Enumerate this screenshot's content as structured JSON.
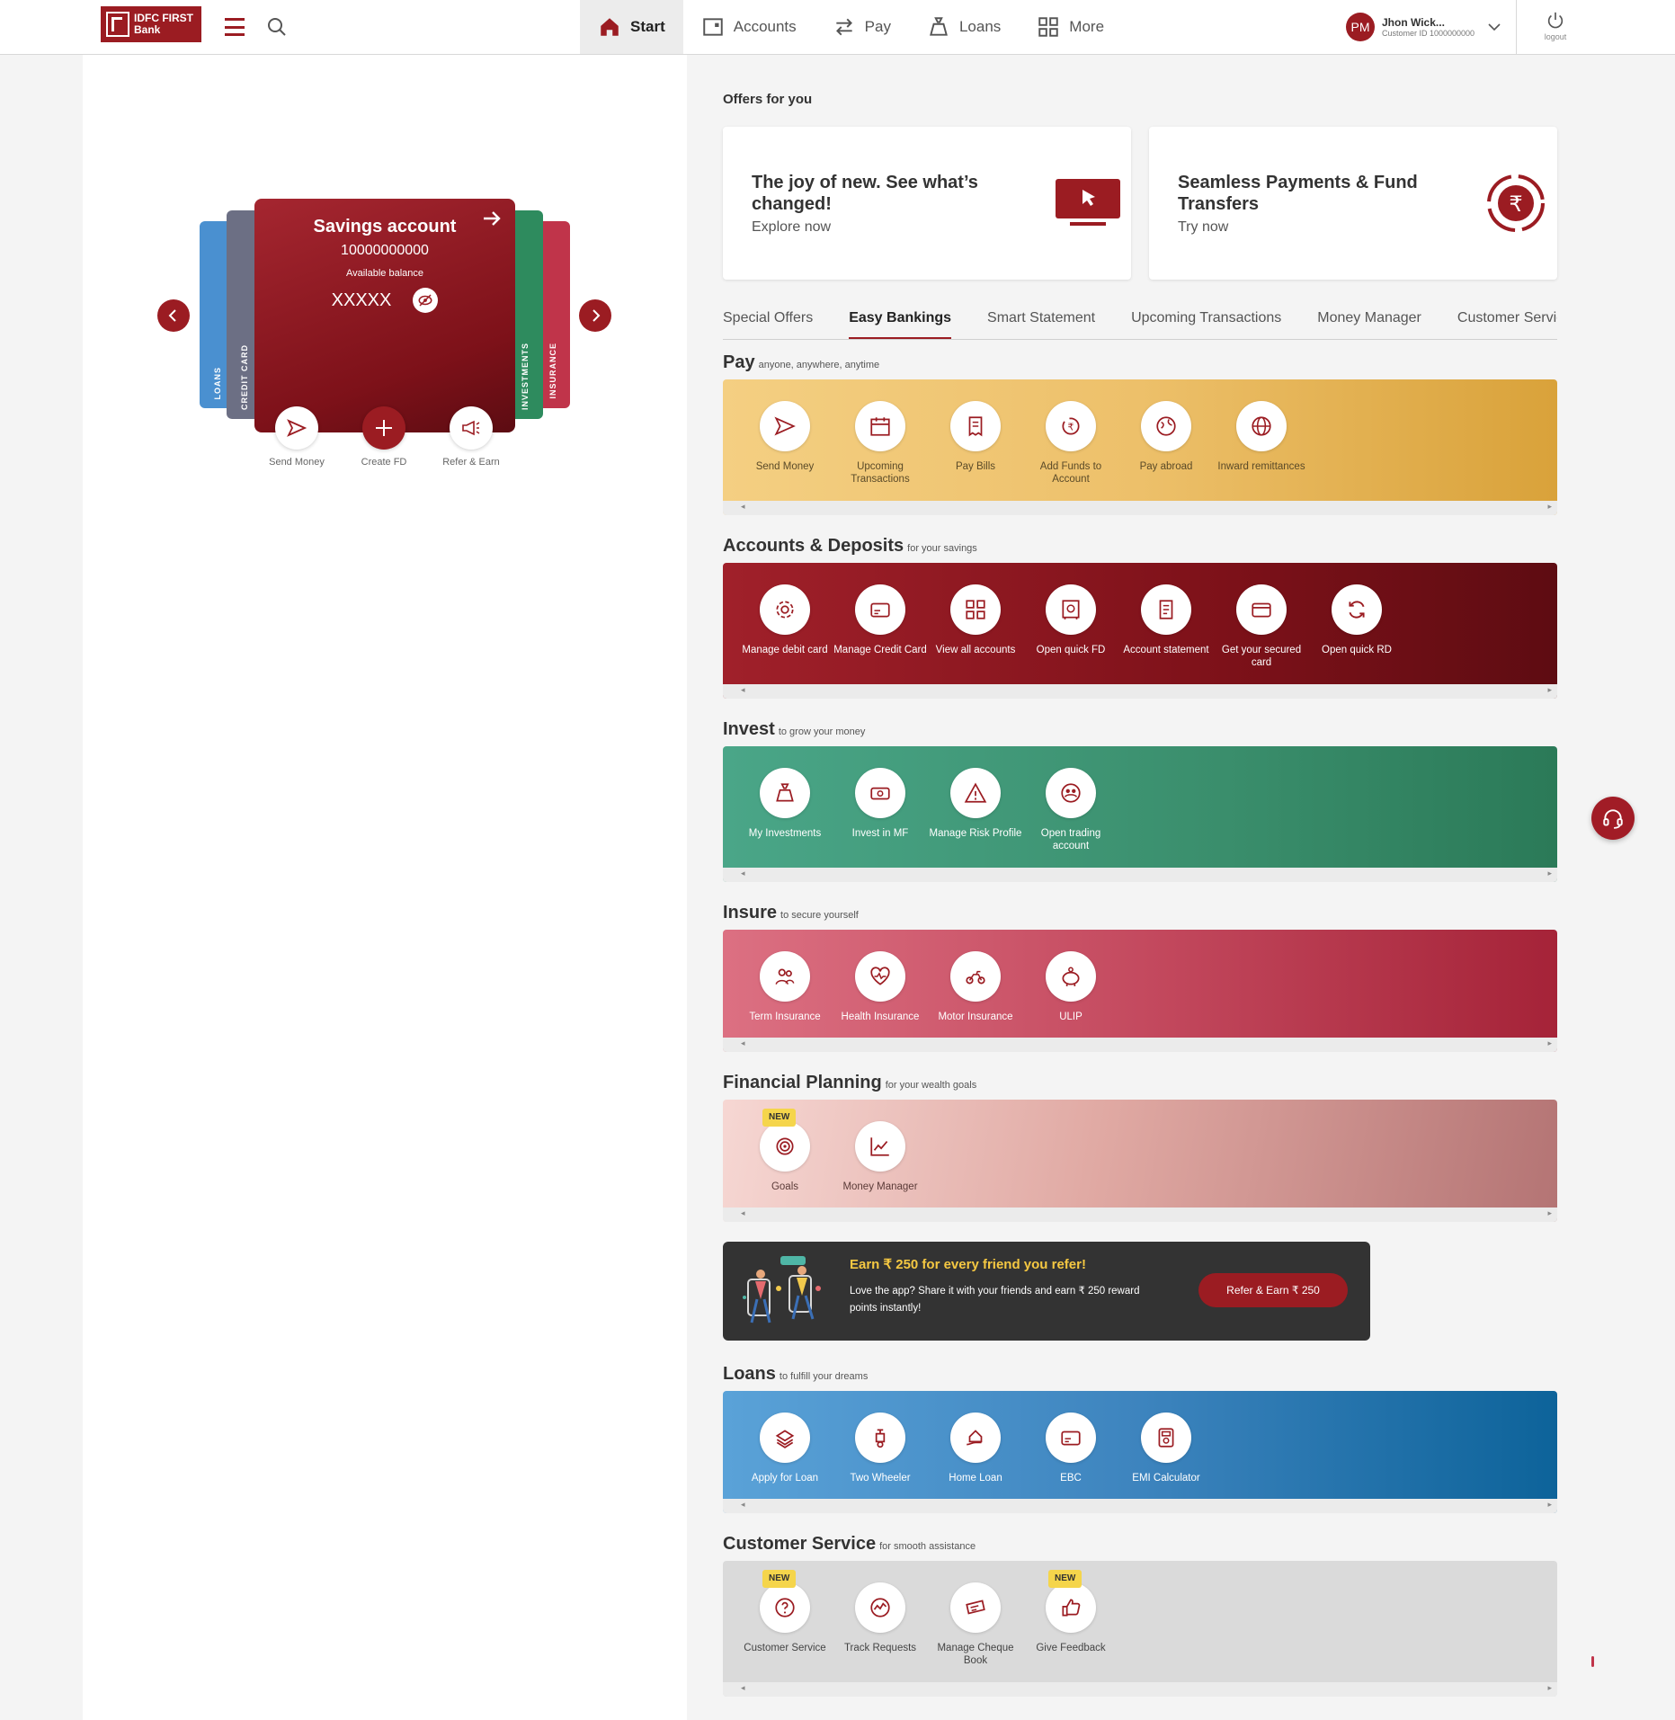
{
  "brand": {
    "name_line1": "IDFC FIRST",
    "name_line2": "Bank",
    "color": "#9b1c22"
  },
  "nav": {
    "items": [
      {
        "label": "Start",
        "icon": "home-icon",
        "active": true
      },
      {
        "label": "Accounts",
        "icon": "accounts-icon"
      },
      {
        "label": "Pay",
        "icon": "transfer-icon"
      },
      {
        "label": "Loans",
        "icon": "moneybag-icon"
      },
      {
        "label": "More",
        "icon": "grid-icon"
      }
    ]
  },
  "user": {
    "initials": "PM",
    "name": "Jhon Wick...",
    "customer_id": "Customer ID 1000000000",
    "logout_label": "logout"
  },
  "account_carousel": {
    "side_cards": [
      "LOANS",
      "CREDIT CARD",
      "INVESTMENTS",
      "INSURANCE"
    ],
    "main": {
      "title": "Savings account",
      "number": "10000000000",
      "balance_label": "Available balance",
      "balance": "XXXXX"
    },
    "quick_actions": [
      "Send Money",
      "Create FD",
      "Refer & Earn"
    ]
  },
  "offers": {
    "title": "Offers for you",
    "cards": [
      {
        "title": "The joy of new. See what’s changed!",
        "link": "Explore now"
      },
      {
        "title": "Seamless Payments & Fund Transfers",
        "link": "Try now"
      }
    ]
  },
  "tabs": [
    "Special Offers",
    "Easy Bankings",
    "Smart Statement",
    "Upcoming Transactions",
    "Money Manager",
    "Customer Servic"
  ],
  "active_tab": "Easy Bankings",
  "sections": {
    "pay": {
      "title": "Pay",
      "subtitle": "anyone, anywhere, anytime",
      "items": [
        "Send Money",
        "Upcoming Transactions",
        "Pay Bills",
        "Add Funds to Account",
        "Pay abroad",
        "Inward remittances"
      ]
    },
    "accounts": {
      "title": "Accounts & Deposits",
      "subtitle": "for your savings",
      "items": [
        "Manage debit card",
        "Manage Credit Card",
        "View all accounts",
        "Open quick FD",
        "Account statement",
        "Get your secured card",
        "Open quick RD"
      ]
    },
    "invest": {
      "title": "Invest",
      "subtitle": "to grow your money",
      "items": [
        "My Investments",
        "Invest in MF",
        "Manage Risk Profile",
        "Open trading account"
      ]
    },
    "insure": {
      "title": "Insure",
      "subtitle": "to secure yourself",
      "items": [
        "Term Insurance",
        "Health Insurance",
        "Motor Insurance",
        "ULIP"
      ]
    },
    "financial": {
      "title": "Financial Planning",
      "subtitle": "for your wealth goals",
      "items": [
        "Goals",
        "Money Manager"
      ],
      "badge": "NEW"
    },
    "loans": {
      "title": "Loans",
      "subtitle": "to fulfill your dreams",
      "items": [
        "Apply for Loan",
        "Two Wheeler",
        "Home Loan",
        "EBC",
        "EMI Calculator"
      ]
    },
    "customer_service": {
      "title": "Customer Service",
      "subtitle": "for smooth assistance",
      "items": [
        "Customer Service",
        "Track Requests",
        "Manage Cheque Book",
        "Give Feedback"
      ],
      "badge": "NEW"
    }
  },
  "referral": {
    "title": "Earn ₹ 250 for every friend you refer!",
    "text": "Love the app? Share it with your friends and earn ₹ 250 reward points instantly!",
    "button": "Refer & Earn ₹ 250"
  }
}
